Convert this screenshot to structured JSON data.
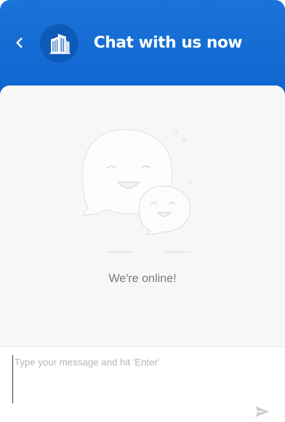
{
  "header": {
    "title": "Chat with us now",
    "back_icon": "chevron-left-icon",
    "logo_icon": "buildings-icon"
  },
  "main": {
    "status_text": "We're online!",
    "illustration_icon": "chat-bubbles-smiling-icon"
  },
  "composer": {
    "placeholder": "Type your message and hit 'Enter'",
    "value": "",
    "send_icon": "send-icon"
  },
  "colors": {
    "header_bg": "#1a73d9",
    "logo_bg": "#0d5bb8",
    "panel_bg": "#f7f7f7",
    "status_text": "#7a7a7a",
    "placeholder": "#b5b5b5"
  }
}
